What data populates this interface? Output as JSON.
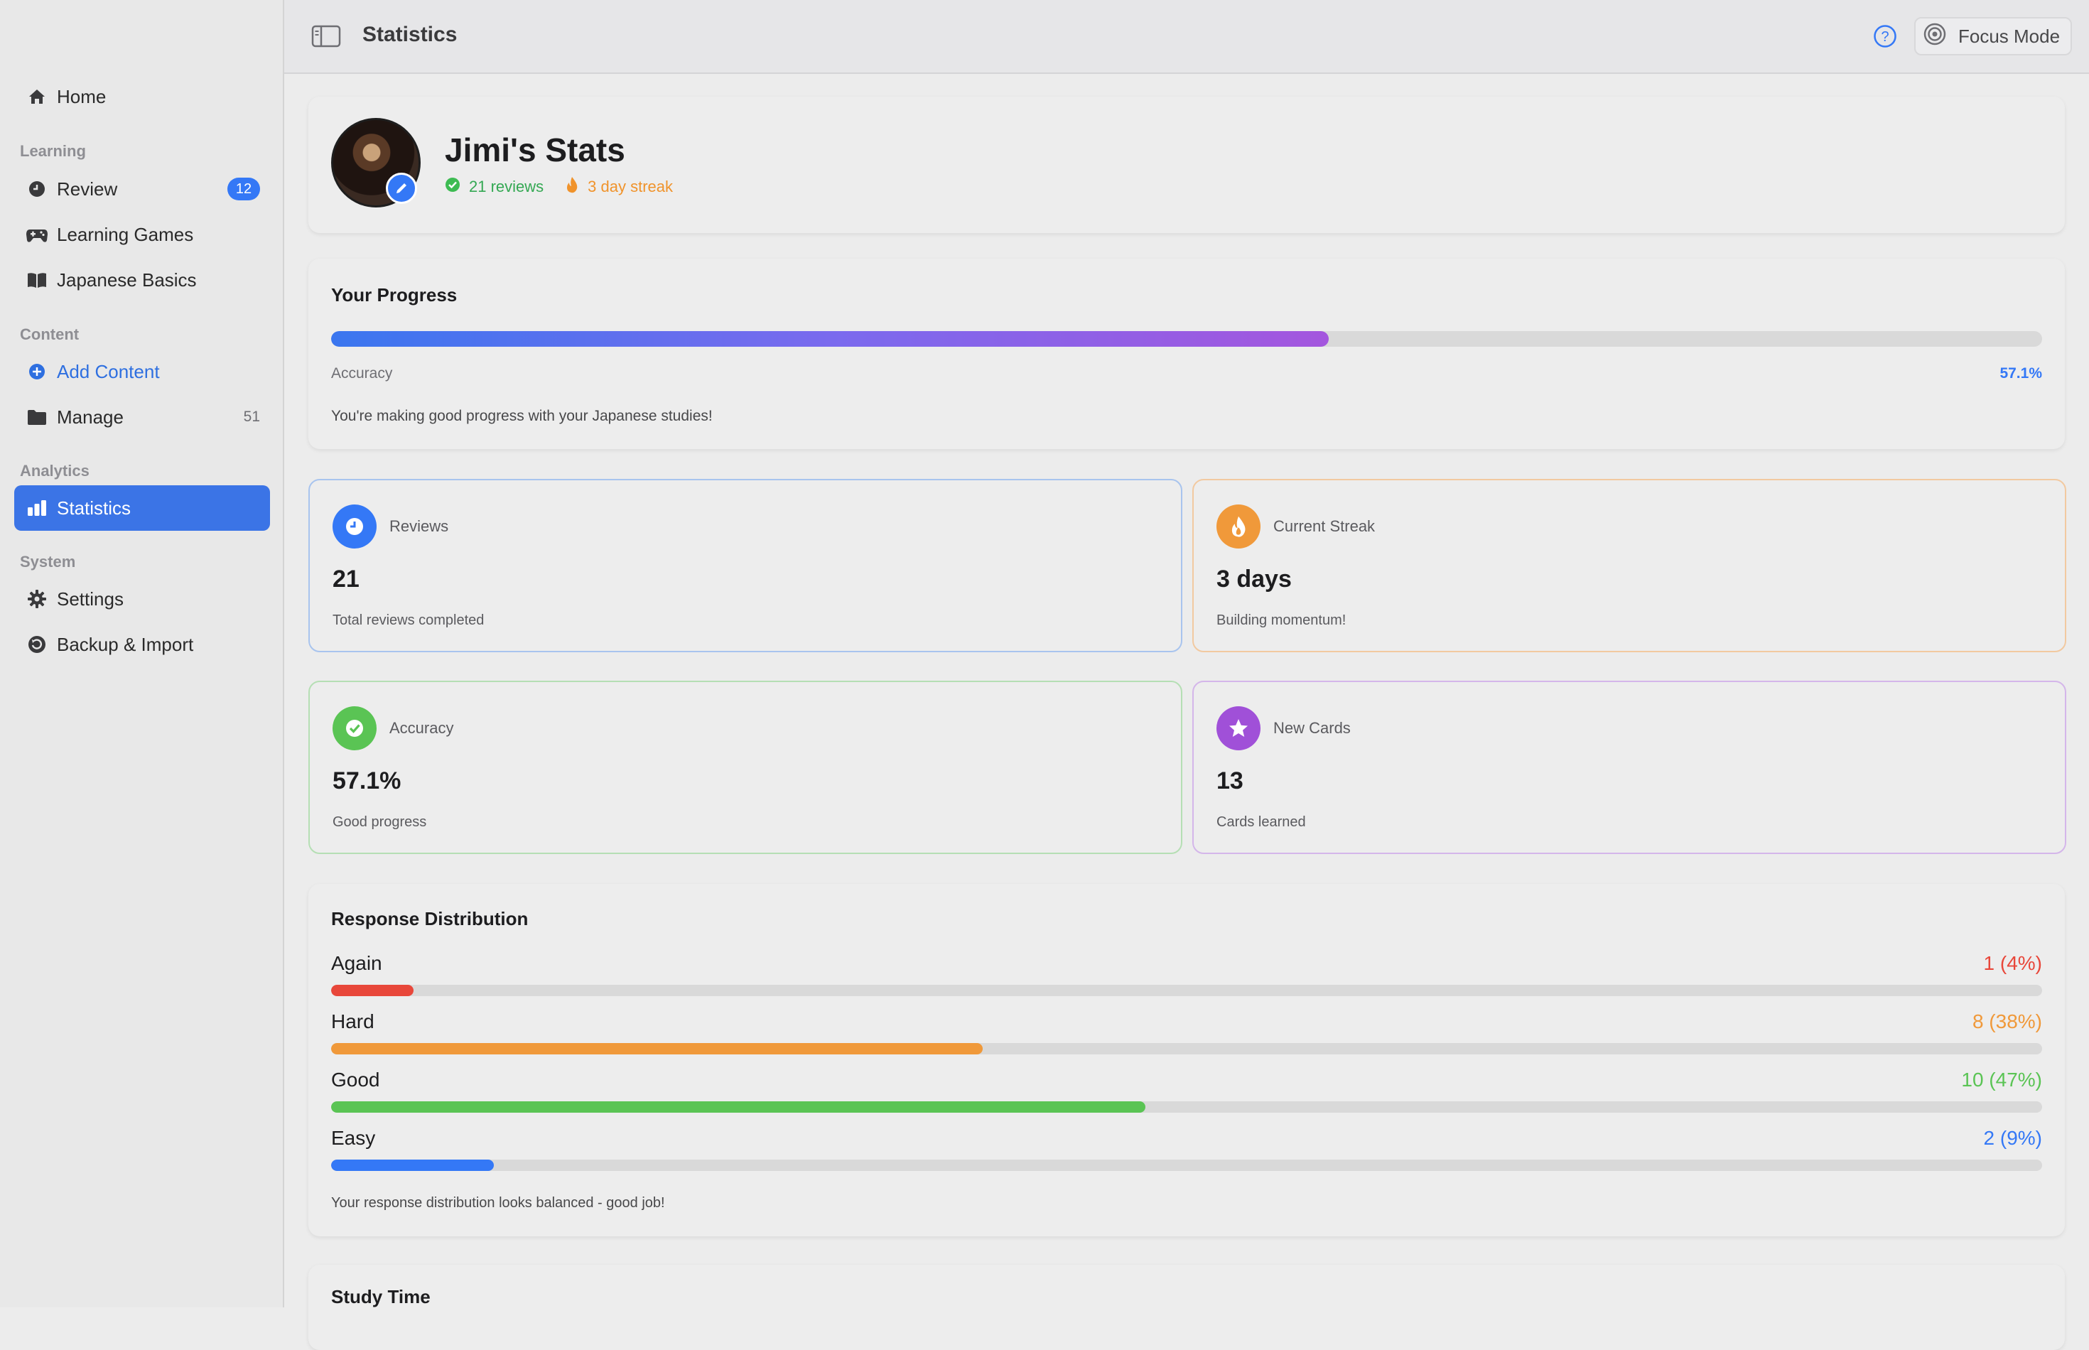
{
  "sidebar": {
    "home": "Home",
    "sections": {
      "learning": "Learning",
      "content": "Content",
      "analytics": "Analytics",
      "system": "System"
    },
    "review": {
      "label": "Review",
      "badge": "12"
    },
    "learning_games": "Learning Games",
    "japanese_basics": "Japanese Basics",
    "add_content": "Add Content",
    "manage": {
      "label": "Manage",
      "count": "51"
    },
    "statistics": "Statistics",
    "settings": "Settings",
    "backup": "Backup & Import"
  },
  "topbar": {
    "title": "Statistics",
    "focus_mode": "Focus Mode"
  },
  "profile": {
    "name": "Jimi's Stats",
    "reviews": "21 reviews",
    "streak": "3 day streak"
  },
  "progress": {
    "title": "Your Progress",
    "accuracy_label": "Accuracy",
    "accuracy_value": "57.1%",
    "accuracy_fraction": 0.583,
    "message": "You're making good progress with your Japanese studies!"
  },
  "stats": {
    "reviews": {
      "label": "Reviews",
      "value": "21",
      "desc": "Total reviews completed"
    },
    "streak": {
      "label": "Current Streak",
      "value": "3 days",
      "desc": "Building momentum!"
    },
    "accuracy": {
      "label": "Accuracy",
      "value": "57.1%",
      "desc": "Good progress"
    },
    "new_cards": {
      "label": "New Cards",
      "value": "13",
      "desc": "Cards learned"
    }
  },
  "distribution": {
    "title": "Response Distribution",
    "rows": [
      {
        "name": "Again",
        "value": "1 (4%)",
        "fraction": 0.048,
        "color": "#e8473a"
      },
      {
        "name": "Hard",
        "value": "8 (38%)",
        "fraction": 0.381,
        "color": "#f0993a"
      },
      {
        "name": "Good",
        "value": "10 (47%)",
        "fraction": 0.476,
        "color": "#5ac454"
      },
      {
        "name": "Easy",
        "value": "2 (9%)",
        "fraction": 0.095,
        "color": "#3478f6"
      }
    ],
    "message": "Your response distribution looks balanced - good job!"
  },
  "study_time": {
    "title": "Study Time"
  },
  "colors": {
    "accent": "#3478f6",
    "active_nav": "#3b74e6",
    "green": "#34a853",
    "orange": "#f0932b",
    "purple": "#a050d8"
  }
}
